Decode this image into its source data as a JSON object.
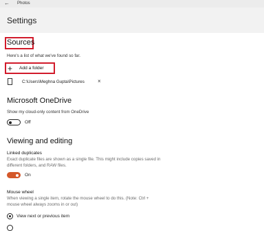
{
  "window": {
    "app_name": "Photos",
    "back_icon": "back-arrow-icon"
  },
  "header": {
    "title": "Settings"
  },
  "sources": {
    "title": "Sources",
    "description": "Here's a list of what we've found so far.",
    "add_folder_label": "Add a folder",
    "add_icon": "plus-icon",
    "folders": [
      {
        "path": "C:\\Users\\Meghna Gupta\\Pictures",
        "icon": "folder-document-icon",
        "remove_icon": "close-icon",
        "remove_glyph": "×"
      }
    ],
    "highlight_color": "#d11a2a"
  },
  "onedrive": {
    "title": "Microsoft OneDrive",
    "description": "Show my cloud-only content from OneDrive",
    "toggle_state": "Off"
  },
  "viewing": {
    "title": "Viewing and editing",
    "linked_duplicates": {
      "label": "Linked duplicates",
      "description_line1": "Exact duplicate files are shown as a single file. This might include copies saved in",
      "description_line2": "different folders, and RAW files.",
      "toggle_state": "On",
      "toggle_color": "#d4582a"
    },
    "mouse_wheel": {
      "label": "Mouse wheel",
      "description_line1": "When viewing a single item, rotate the mouse wheel to do this. (Note: Ctrl +",
      "description_line2": "mouse wheel always zooms in or out)",
      "options": [
        {
          "label": "View next or previous item",
          "selected": true
        },
        {
          "label": "",
          "selected": false
        }
      ]
    }
  }
}
